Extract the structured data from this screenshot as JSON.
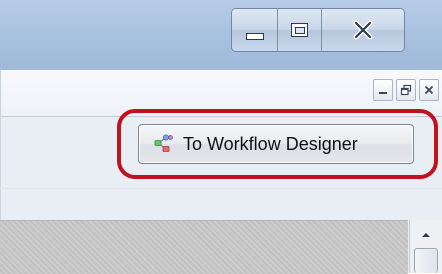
{
  "window": {
    "title": "",
    "controls": {
      "minimize_icon": "minimize-icon",
      "maximize_icon": "maximize-icon",
      "close_icon": "close-icon"
    }
  },
  "view": {
    "controls": {
      "minimize_icon": "view-minimize-icon",
      "restore_icon": "view-restore-icon",
      "close_icon": "view-close-icon"
    }
  },
  "toolbar": {
    "workflow_button_label": "To Workflow Designer",
    "workflow_button_icon": "workflow-nodes-icon"
  },
  "colors": {
    "highlight_ring": "#c1121f",
    "title_bar": "#a9c2e0"
  }
}
